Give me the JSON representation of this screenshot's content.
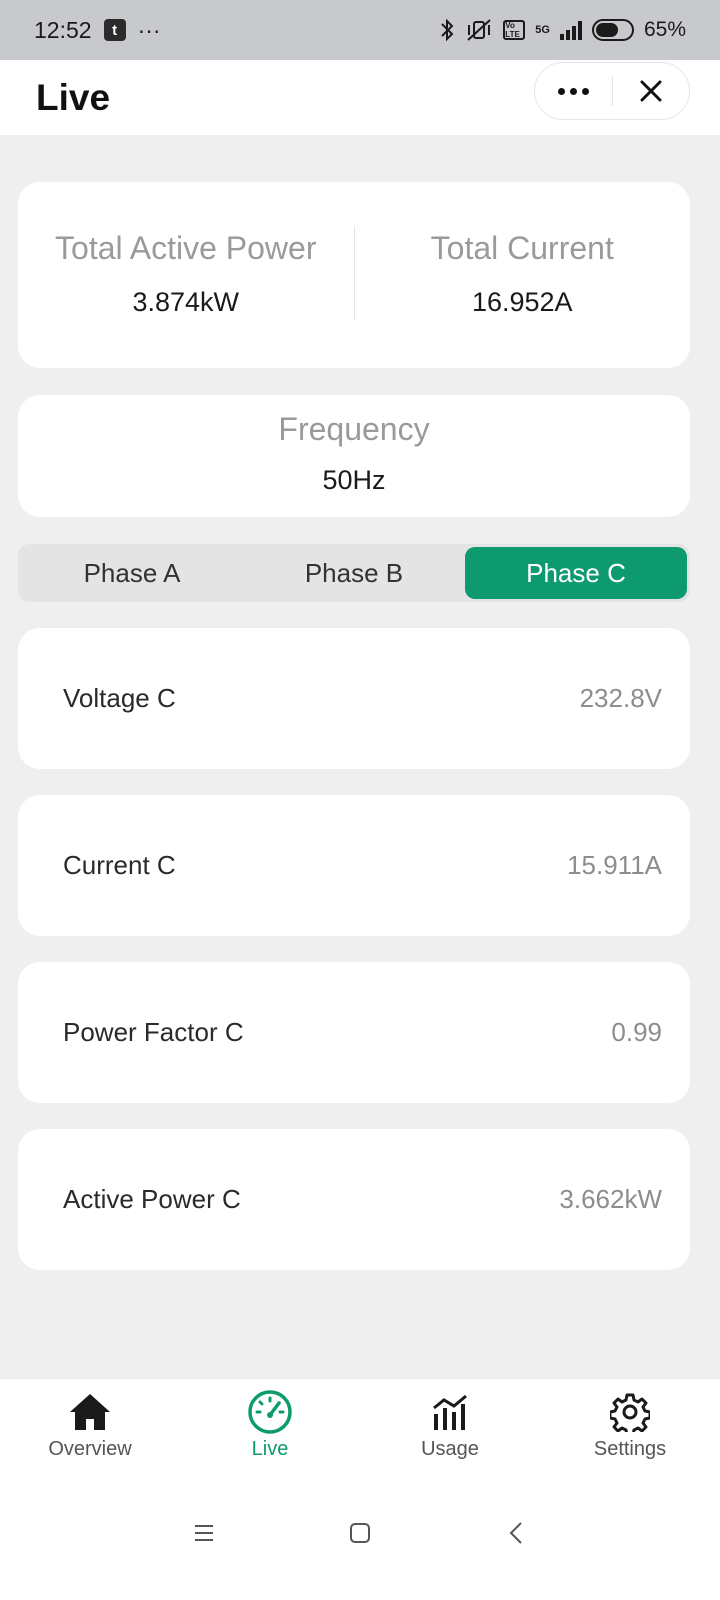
{
  "status_bar": {
    "time": "12:52",
    "more": "···",
    "battery": "65%",
    "network": "5G",
    "volte": "Vo LTE"
  },
  "header": {
    "title": "Live"
  },
  "summary": {
    "total_active_power_label": "Total Active Power",
    "total_active_power_value": "3.874kW",
    "total_current_label": "Total Current",
    "total_current_value": "16.952A"
  },
  "frequency": {
    "label": "Frequency",
    "value": "50Hz"
  },
  "phase_tabs": [
    "Phase A",
    "Phase B",
    "Phase C"
  ],
  "active_phase": "Phase C",
  "metrics": [
    {
      "label": "Voltage C",
      "value": "232.8V"
    },
    {
      "label": "Current C",
      "value": "15.911A"
    },
    {
      "label": "Power Factor C",
      "value": "0.99"
    },
    {
      "label": "Active Power C",
      "value": "3.662kW"
    }
  ],
  "bottom_nav": [
    {
      "label": "Overview",
      "icon": "home-icon"
    },
    {
      "label": "Live",
      "icon": "speedometer-icon"
    },
    {
      "label": "Usage",
      "icon": "bar-chart-icon"
    },
    {
      "label": "Settings",
      "icon": "gear-icon"
    }
  ],
  "colors": {
    "accent": "#0e9a6f",
    "background": "#efefef"
  }
}
